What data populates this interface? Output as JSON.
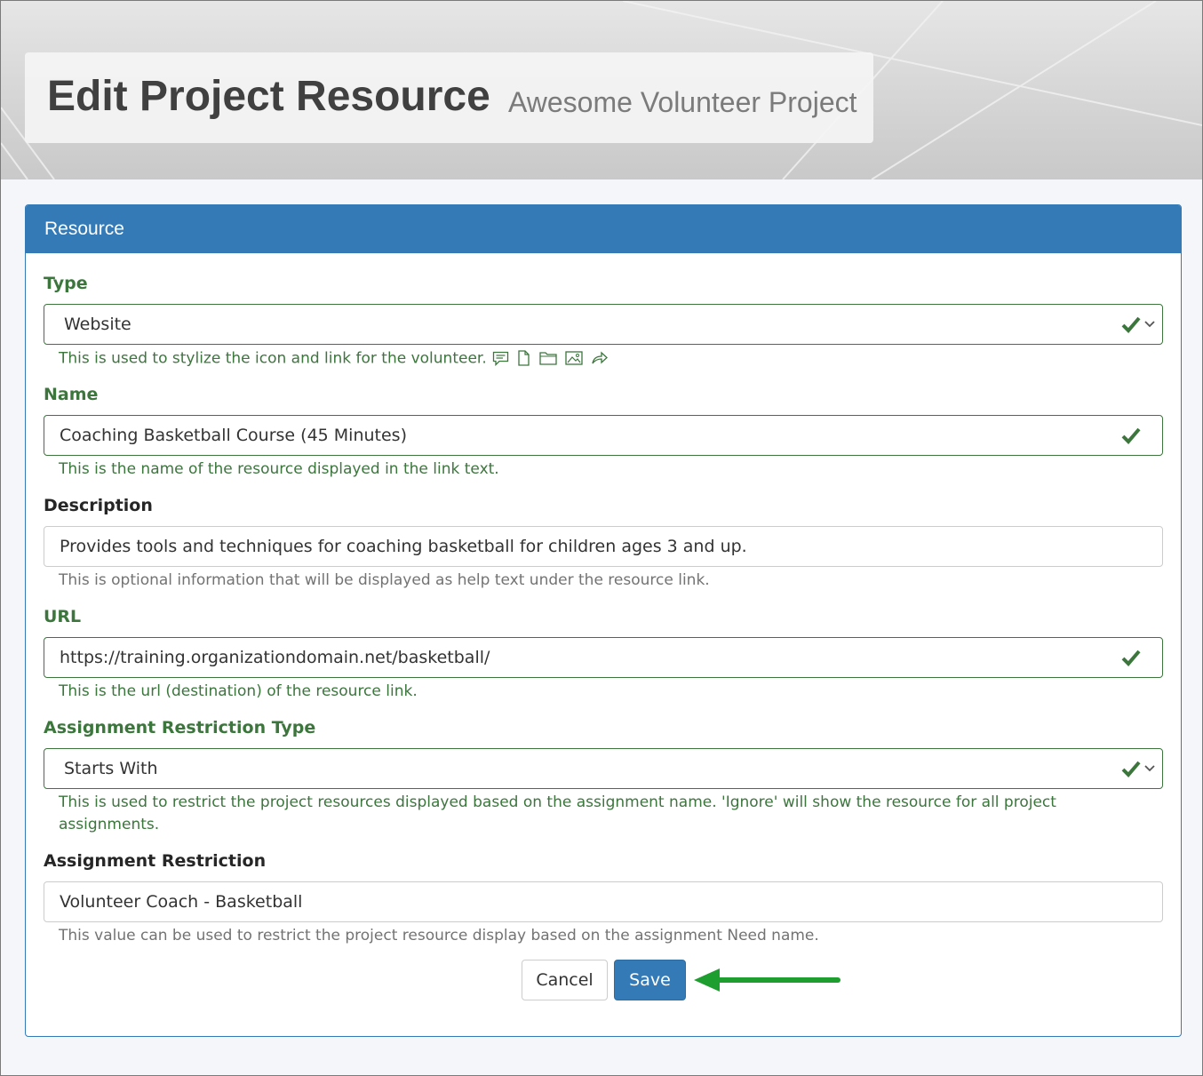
{
  "header": {
    "title": "Edit Project Resource",
    "subtitle": "Awesome Volunteer Project"
  },
  "panel": {
    "heading": "Resource"
  },
  "fields": {
    "type": {
      "label": "Type",
      "value": "Website",
      "help": "This is used to stylize the icon and link for the volunteer.",
      "icons": [
        "comment-icon",
        "file-icon",
        "folder-icon",
        "image-icon",
        "share-icon"
      ]
    },
    "name": {
      "label": "Name",
      "value": "Coaching Basketball Course (45 Minutes)",
      "help": "This is the name of the resource displayed in the link text."
    },
    "description": {
      "label": "Description",
      "value": "Provides tools and techniques for coaching basketball for children ages 3 and up.",
      "help": "This is optional information that will be displayed as help text under the resource link."
    },
    "url": {
      "label": "URL",
      "value": "https://training.organizationdomain.net/basketball/",
      "help": "This is the url (destination) of the resource link."
    },
    "restriction_type": {
      "label": "Assignment Restriction Type",
      "value": "Starts With",
      "help": "This is used to restrict the project resources displayed based on the assignment name. 'Ignore' will show the resource for all project assignments."
    },
    "restriction": {
      "label": "Assignment Restriction",
      "value": "Volunteer Coach - Basketball",
      "help": "This value can be used to restrict the project resource display based on the assignment Need name."
    }
  },
  "buttons": {
    "cancel": "Cancel",
    "save": "Save"
  },
  "colors": {
    "primary": "#337ab7",
    "success": "#3c763d",
    "annotation_arrow": "#1e9e2e"
  }
}
